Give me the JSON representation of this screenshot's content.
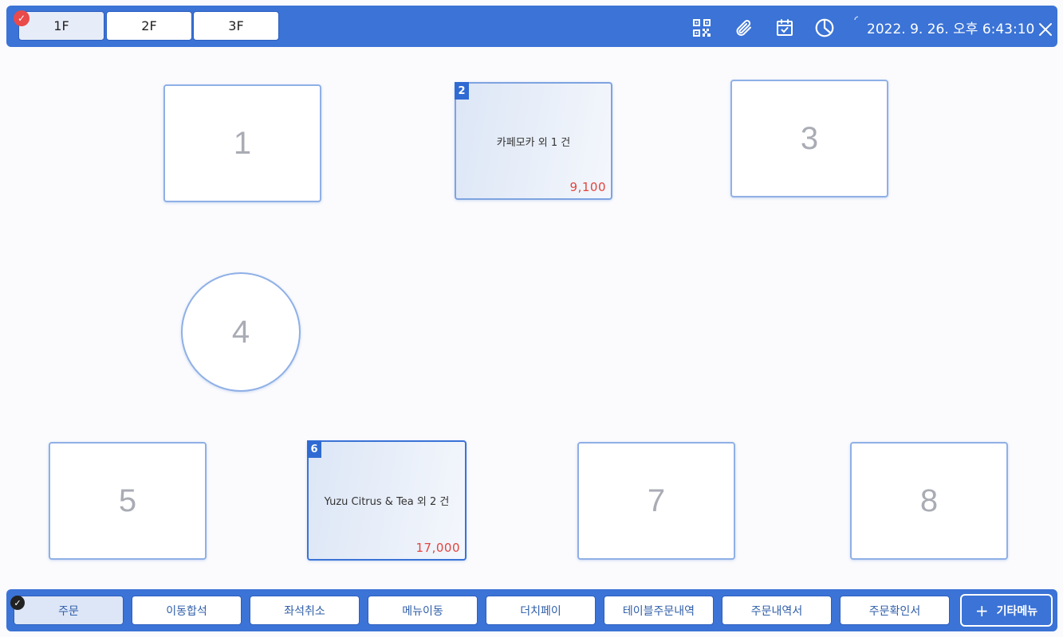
{
  "floors": [
    {
      "label": "1F",
      "active": true
    },
    {
      "label": "2F",
      "active": false
    },
    {
      "label": "3F",
      "active": false
    }
  ],
  "header": {
    "datetime": "2022. 9. 26. 오후 6:43:10",
    "icons": [
      "qr-code-icon",
      "paperclip-icon",
      "calendar-check-icon",
      "pie-chart-icon",
      "close-icon"
    ]
  },
  "tables": [
    {
      "number": "1",
      "shape": "rect"
    },
    {
      "number": "2",
      "shape": "rect",
      "summary": "카페모카 외 1 건",
      "amount": "9,100"
    },
    {
      "number": "3",
      "shape": "rect"
    },
    {
      "number": "4",
      "shape": "round"
    },
    {
      "number": "5",
      "shape": "rect"
    },
    {
      "number": "6",
      "shape": "rect",
      "summary": "Yuzu Citrus & Tea 외 2 건",
      "amount": "17,000",
      "selected": true
    },
    {
      "number": "7",
      "shape": "rect"
    },
    {
      "number": "8",
      "shape": "rect"
    }
  ],
  "actions": [
    {
      "label": "주문",
      "active": true
    },
    {
      "label": "이동합석"
    },
    {
      "label": "좌석취소"
    },
    {
      "label": "메뉴이동"
    },
    {
      "label": "더치페이"
    },
    {
      "label": "테이블주문내역"
    },
    {
      "label": "주문내역서"
    },
    {
      "label": "주문확인서"
    }
  ],
  "etc_menu": {
    "plus": "+",
    "label": "기타메뉴"
  },
  "colors": {
    "accent": "#3b73d6",
    "amount": "#e2453e",
    "badge": "#2f6bd2"
  }
}
